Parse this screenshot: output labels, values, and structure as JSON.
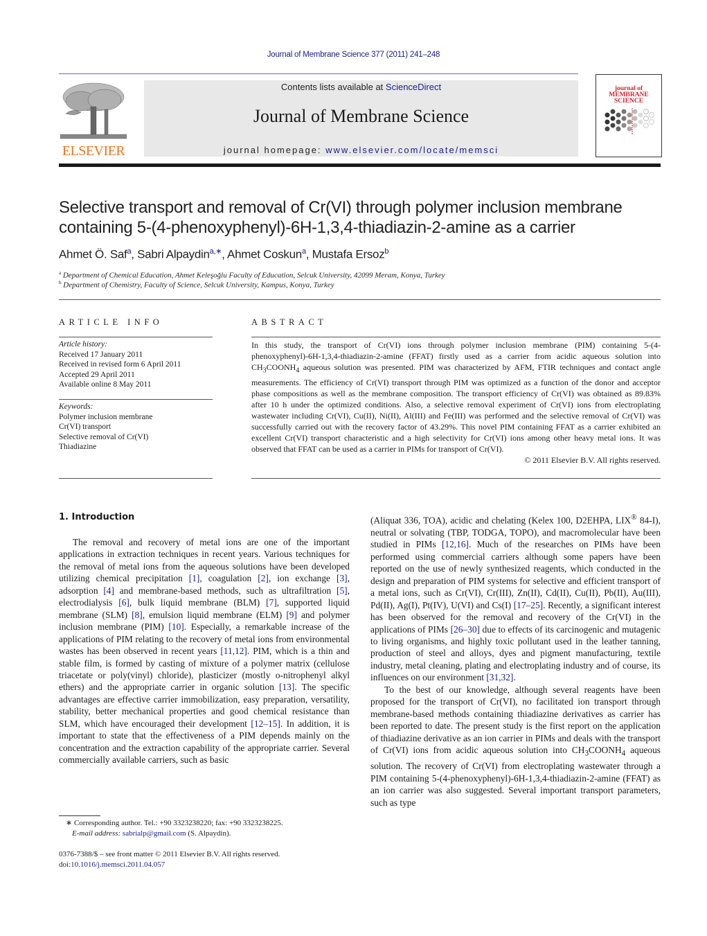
{
  "header": {
    "journal_reference": "Journal of Membrane Science 377 (2011) 241–248",
    "contents_prefix": "Contents lists available at ",
    "contents_link": "ScienceDirect",
    "journal_title": "Journal of Membrane Science",
    "homepage_prefix": "journal homepage: ",
    "homepage_link": "www.elsevier.com/locate/memsci",
    "publisher_logo_text": "ELSEVIER",
    "cover_title_lines": [
      "journal of",
      "MEMBRANE",
      "SCIENCE"
    ],
    "colors": {
      "publisher_orange": "#e87722",
      "link_blue": "#1b1b8f",
      "cover_red": "#c8282d",
      "masthead_gray": "#e8e8e8"
    }
  },
  "article": {
    "title_line1": "Selective transport and removal of Cr(VI) through polymer inclusion membrane",
    "title_line2": "containing 5-(4-phenoxyphenyl)-6H-1,3,4-thiadiazin-2-amine as a carrier",
    "authors": [
      {
        "name": "Ahmet Ö. Saf",
        "sup": "a"
      },
      {
        "name": "Sabri Alpaydin",
        "sup": "a,∗"
      },
      {
        "name": "Ahmet Coskun",
        "sup": "a"
      },
      {
        "name": "Mustafa Ersoz",
        "sup": "b"
      }
    ],
    "affiliations": [
      {
        "sup": "a",
        "text": "Department of Chemical Education, Ahmet Keleşoğlu Faculty of Education, Selcuk University, 42099 Meram, Konya, Turkey"
      },
      {
        "sup": "b",
        "text": "Department of Chemistry, Faculty of Science, Selcuk University, Kampus, Konya, Turkey"
      }
    ]
  },
  "article_info": {
    "heading": "ARTICLE INFO",
    "history_label": "Article history:",
    "history": [
      "Received 17 January 2011",
      "Received in revised form 6 April 2011",
      "Accepted 29 April 2011",
      "Available online 8 May 2011"
    ],
    "keywords_label": "Keywords:",
    "keywords": [
      "Polymer inclusion membrane",
      "Cr(VI) transport",
      "Selective removal of Cr(VI)",
      "Thiadiazine"
    ]
  },
  "abstract": {
    "heading": "ABSTRACT",
    "part1": "In this study, the transport of Cr(VI) ions through polymer inclusion membrane (PIM) containing 5-(4-phenoxyphenyl)-6H-1,3,4-thiadiazin-2-amine (FFAT) firstly used as a carrier from acidic aqueous solution into CH",
    "sub1": "3",
    "part2": "COONH",
    "sub2": "4",
    "part3": " aqueous solution was presented. PIM was characterized by AFM, FTIR techniques and contact angle measurements. The efficiency of Cr(VI) transport through PIM was optimized as a function of the donor and acceptor phase compositions as well as the membrane composition. The transport efficiency of Cr(VI) was obtained as 89.83% after 10 h under the optimized conditions. Also, a selective removal experiment of Cr(VI) ions from electroplating wastewater including Cr(VI), Cu(II), Ni(II), Al(III) and Fe(III) was performed and the selective removal of Cr(VI) was successfully carried out with the recovery factor of 43.29%. This novel PIM containing FFAT as a carrier exhibited an excellent Cr(VI) transport characteristic and a high selectivity for Cr(VI) ions among other heavy metal ions. It was observed that FFAT can be used as a carrier in PIMs for transport of Cr(VI).",
    "copyright": "© 2011 Elsevier B.V. All rights reserved."
  },
  "intro": {
    "heading": "1.  Introduction",
    "left_segments": [
      "The removal and recovery of metal ions are one of the important applications in extraction techniques in recent years. Various techniques for the removal of metal ions from the aqueous solutions have been developed utilizing chemical precipitation ",
      "[1]",
      ", coagulation ",
      "[2]",
      ", ion exchange ",
      "[3]",
      ", adsorption ",
      "[4]",
      " and membrane-based methods, such as ultrafiltration ",
      "[5]",
      ", electrodialysis ",
      "[6]",
      ", bulk liquid membrane (BLM) ",
      "[7]",
      ", supported liquid membrane (SLM) ",
      "[8]",
      ", emulsion liquid membrane (ELM) ",
      "[9]",
      " and polymer inclusion membrane (PIM) ",
      "[10]",
      ". Especially, a remarkable increase of the applications of PIM relating to the recovery of metal ions from environmental wastes has been observed in recent years ",
      "[11,12]",
      ". PIM, which is a thin and stable film, is formed by casting of mixture of a polymer matrix (cellulose triacetate or poly(vinyl) chloride), plasticizer (mostly o-nitrophenyl alkyl ethers) and the appropriate carrier in organic solution ",
      "[13]",
      ". The specific advantages are effective carrier immobilization, easy preparation, versatility, stability, better mechanical properties and good chemical resistance than SLM, which have encouraged their development ",
      "[12–15]",
      ". In addition, it is important to state that the effectiveness of a PIM depends mainly on the concentration and the extraction capability of the appropriate carrier. Several commercially available carriers, such as basic"
    ],
    "right_p1_segments": [
      "(Aliquat 336, TOA), acidic and chelating (Kelex 100, D2EHPA, LIX",
      "®",
      " 84-I), neutral or solvating (TBP, TODGA, TOPO), and macromolecular have been studied in PIMs ",
      "[12,16]",
      ". Much of the researches on PIMs have been performed using commercial carriers although some papers have been reported on the use of newly synthesized reagents, which conducted in the design and preparation of PIM systems for selective and efficient transport of a metal ions, such as Cr(VI), Cr(III), Zn(II), Cd(II), Cu(II), Pb(II), Au(III), Pd(II), Ag(I), Pt(IV), U(VI) and Cs(I) ",
      "[17–25]",
      ". Recently, a significant interest has been observed for the removal and recovery of the Cr(VI) in the applications of PIMs ",
      "[26–30]",
      " due to effects of its carcinogenic and mutagenic to living organisms, and highly toxic pollutant used in the leather tanning, production of steel and alloys, dyes and pigment manufacturing, textile industry, metal cleaning, plating and electroplating industry and of course, its influences on our environment ",
      "[31,32]",
      "."
    ],
    "right_p2_part1": "To the best of our knowledge, although several reagents have been proposed for the transport of Cr(VI), no facilitated ion transport through membrane-based methods containing thiadiazine derivatives as carrier has been reported to date. The present study is the first report on the application of thiadiazine derivative as an ion carrier in PIMs and deals with the transport of Cr(VI) ions from acidic aqueous solution into CH",
    "right_p2_sub1": "3",
    "right_p2_part2": "COONH",
    "right_p2_sub2": "4",
    "right_p2_part3": " aqueous solution. The recovery of Cr(VI) from electroplating wastewater through a PIM containing 5-(4-phenoxyphenyl)-6H-1,3,4-thiadiazin-2-amine (FFAT) as an ion carrier was also suggested. Several important transport parameters, such as type"
  },
  "footnote": {
    "marker": "∗",
    "text": " Corresponding author. Tel.: +90 3323238220; fax: +90 3323238225.",
    "email_label": "E-mail address: ",
    "email": "sabrialp@gmail.com",
    "email_suffix": " (S. Alpaydin)."
  },
  "front_matter": {
    "issn_line": "0376-7388/$ – see front matter © 2011 Elsevier B.V. All rights reserved.",
    "doi_prefix": "doi:",
    "doi": "10.1016/j.memsci.2011.04.057"
  }
}
